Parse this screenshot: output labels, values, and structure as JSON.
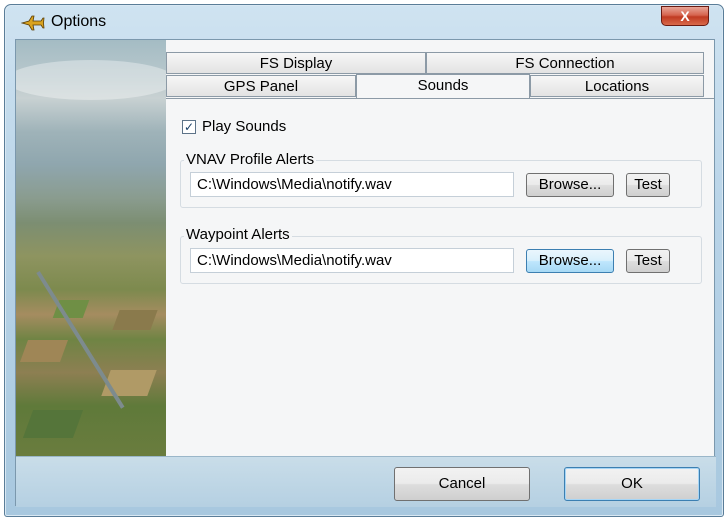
{
  "window": {
    "title": "Options",
    "close_label": "X"
  },
  "tabs": {
    "row1": [
      {
        "label": "FS Display"
      },
      {
        "label": "FS Connection"
      }
    ],
    "row2": [
      {
        "label": "GPS Panel"
      },
      {
        "label": "Sounds",
        "active": true
      },
      {
        "label": "Locations"
      }
    ]
  },
  "sounds": {
    "play_sounds": {
      "label": "Play Sounds",
      "checked": true,
      "check_glyph": "✓"
    },
    "vnav_group": {
      "label": "VNAV Profile Alerts",
      "path_value": "C:\\Windows\\Media\\notify.wav",
      "browse_label": "Browse...",
      "test_label": "Test"
    },
    "waypoint_group": {
      "label": "Waypoint Alerts",
      "path_value": "C:\\Windows\\Media\\notify.wav",
      "browse_label": "Browse...",
      "test_label": "Test"
    }
  },
  "footer": {
    "cancel_label": "Cancel",
    "ok_label": "OK"
  },
  "colors": {
    "accent": "#3c7fb1",
    "close": "#c03a22"
  }
}
